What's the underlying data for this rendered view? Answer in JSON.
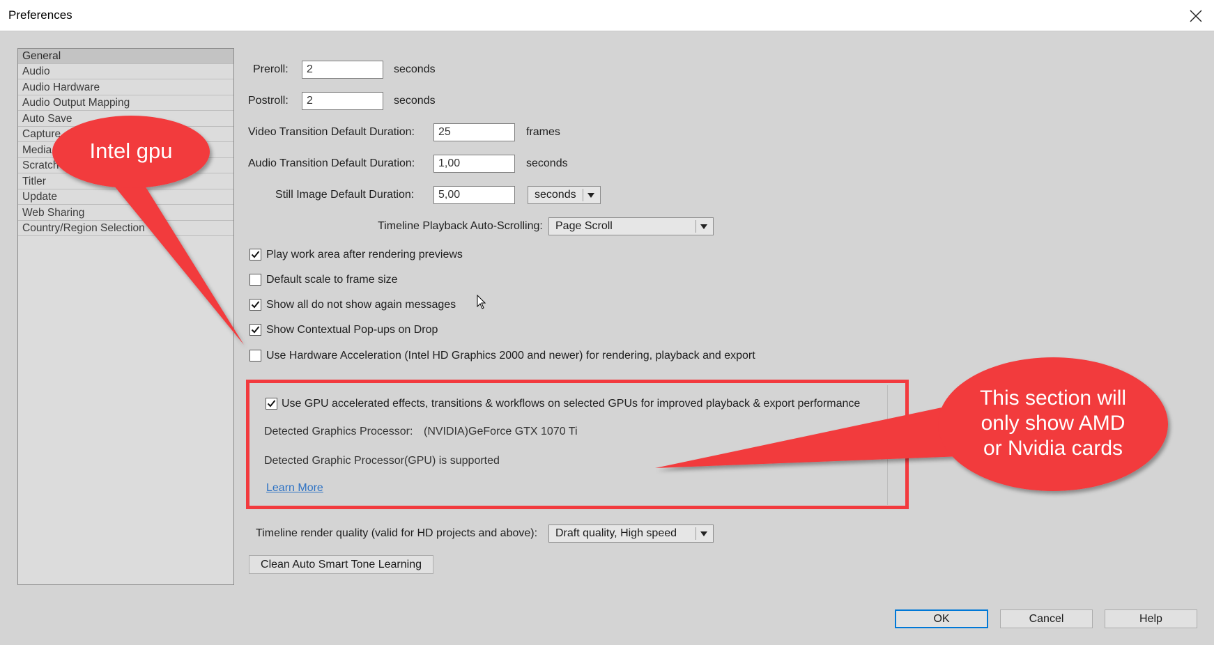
{
  "window": {
    "title": "Preferences"
  },
  "sidebar": {
    "items": [
      {
        "label": "General",
        "selected": true
      },
      {
        "label": "Audio"
      },
      {
        "label": "Audio Hardware"
      },
      {
        "label": "Audio Output Mapping"
      },
      {
        "label": "Auto Save"
      },
      {
        "label": "Capture"
      },
      {
        "label": "Media"
      },
      {
        "label": "Scratch"
      },
      {
        "label": "Titler"
      },
      {
        "label": "Update"
      },
      {
        "label": "Web Sharing"
      },
      {
        "label": "Country/Region Selection"
      }
    ]
  },
  "general": {
    "preroll": {
      "label": "Preroll:",
      "value": "2",
      "unit": "seconds"
    },
    "postroll": {
      "label": "Postroll:",
      "value": "2",
      "unit": "seconds"
    },
    "video_transition": {
      "label": "Video Transition Default Duration:",
      "value": "25",
      "unit": "frames"
    },
    "audio_transition": {
      "label": "Audio Transition Default Duration:",
      "value": "1,00",
      "unit": "seconds"
    },
    "still_image": {
      "label": "Still Image Default Duration:",
      "value": "5,00",
      "unit_select": "seconds"
    },
    "autoscroll": {
      "label": "Timeline Playback Auto-Scrolling:",
      "value": "Page Scroll"
    },
    "checkboxes": [
      {
        "label": "Play work area after rendering previews",
        "checked": true
      },
      {
        "label": "Default scale to frame size",
        "checked": false
      },
      {
        "label": "Show all do not show again messages",
        "checked": true
      },
      {
        "label": "Show Contextual Pop-ups on Drop",
        "checked": true
      },
      {
        "label": "Use Hardware Acceleration (Intel HD Graphics 2000 and newer) for rendering, playback and export",
        "checked": false
      }
    ],
    "gpu": {
      "label": "Use GPU accelerated effects, transitions & workflows on selected GPUs for improved playback & export performance",
      "checked": true,
      "detected_label": "Detected Graphics Processor:",
      "detected_value": "(NVIDIA)GeForce GTX 1070 Ti",
      "supported": "Detected Graphic Processor(GPU) is supported",
      "learn_more": "Learn More"
    },
    "render_quality": {
      "label": "Timeline render quality (valid for HD projects and above):",
      "value": "Draft quality, High speed"
    },
    "clean_button": "Clean Auto Smart Tone Learning"
  },
  "buttons": {
    "ok": "OK",
    "cancel": "Cancel",
    "help": "Help"
  },
  "annotations": {
    "intel": "Intel gpu",
    "amd_nvidia": [
      "This section will",
      "only show AMD",
      "or Nvidia cards"
    ]
  },
  "colors": {
    "annotation_red": "#f23a3e",
    "link_blue": "#2f73c4",
    "ok_focus": "#0078d7"
  }
}
